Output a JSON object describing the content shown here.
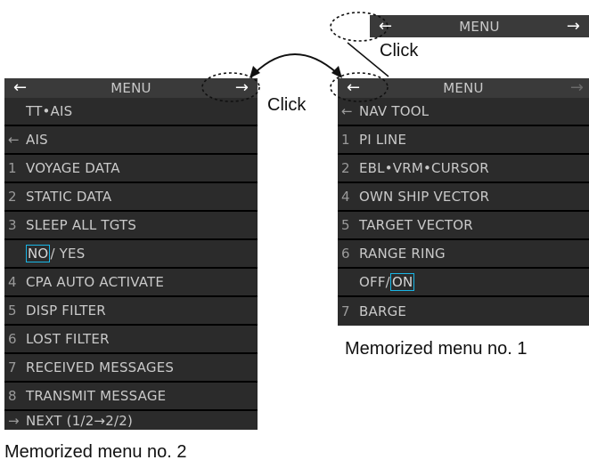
{
  "top_bar": {
    "title": "MENU",
    "left_arrow": "←",
    "right_arrow": "→"
  },
  "left_menu": {
    "title": "MENU",
    "left_arrow": "←",
    "right_arrow": "→",
    "header": "TT•AIS",
    "back_marker": "←",
    "back_label": "AIS",
    "items": [
      {
        "num": "1",
        "label": "VOYAGE DATA"
      },
      {
        "num": "2",
        "label": "STATIC DATA"
      },
      {
        "num": "3",
        "label": "SLEEP ALL TGTS"
      }
    ],
    "sleep_options": {
      "selected": "NO",
      "separator": "/",
      "other": "YES"
    },
    "items2": [
      {
        "num": "4",
        "label": "CPA AUTO ACTIVATE"
      },
      {
        "num": "5",
        "label": "DISP FILTER"
      },
      {
        "num": "6",
        "label": "LOST FILTER"
      },
      {
        "num": "7",
        "label": "RECEIVED MESSAGES"
      },
      {
        "num": "8",
        "label": "TRANSMIT MESSAGE"
      }
    ],
    "next_marker": "→",
    "next_label": "NEXT (1/2→2/2)"
  },
  "right_menu": {
    "title": "MENU",
    "left_arrow": "←",
    "right_arrow": "→",
    "back_marker": "←",
    "back_label": "NAV TOOL",
    "items": [
      {
        "num": "1",
        "label": "PI LINE"
      },
      {
        "num": "2",
        "label": "EBL•VRM•CURSOR"
      },
      {
        "num": "4",
        "label": "OWN SHIP VECTOR"
      },
      {
        "num": "5",
        "label": "TARGET VECTOR"
      },
      {
        "num": "6",
        "label": "RANGE RING"
      }
    ],
    "ring_options": {
      "other": "OFF",
      "separator": "/",
      "selected": "ON"
    },
    "last_item": {
      "num": "7",
      "label": "BARGE"
    }
  },
  "annotations": {
    "click_top": "Click",
    "click_left": "Click",
    "caption_right": "Memorized menu no. 1",
    "caption_left": "Memorized menu no. 2"
  },
  "colors": {
    "panel": "#2b2b2b",
    "title": "#3a3a3a",
    "text": "#c9c9c9",
    "select_box": "#19b6e6"
  }
}
